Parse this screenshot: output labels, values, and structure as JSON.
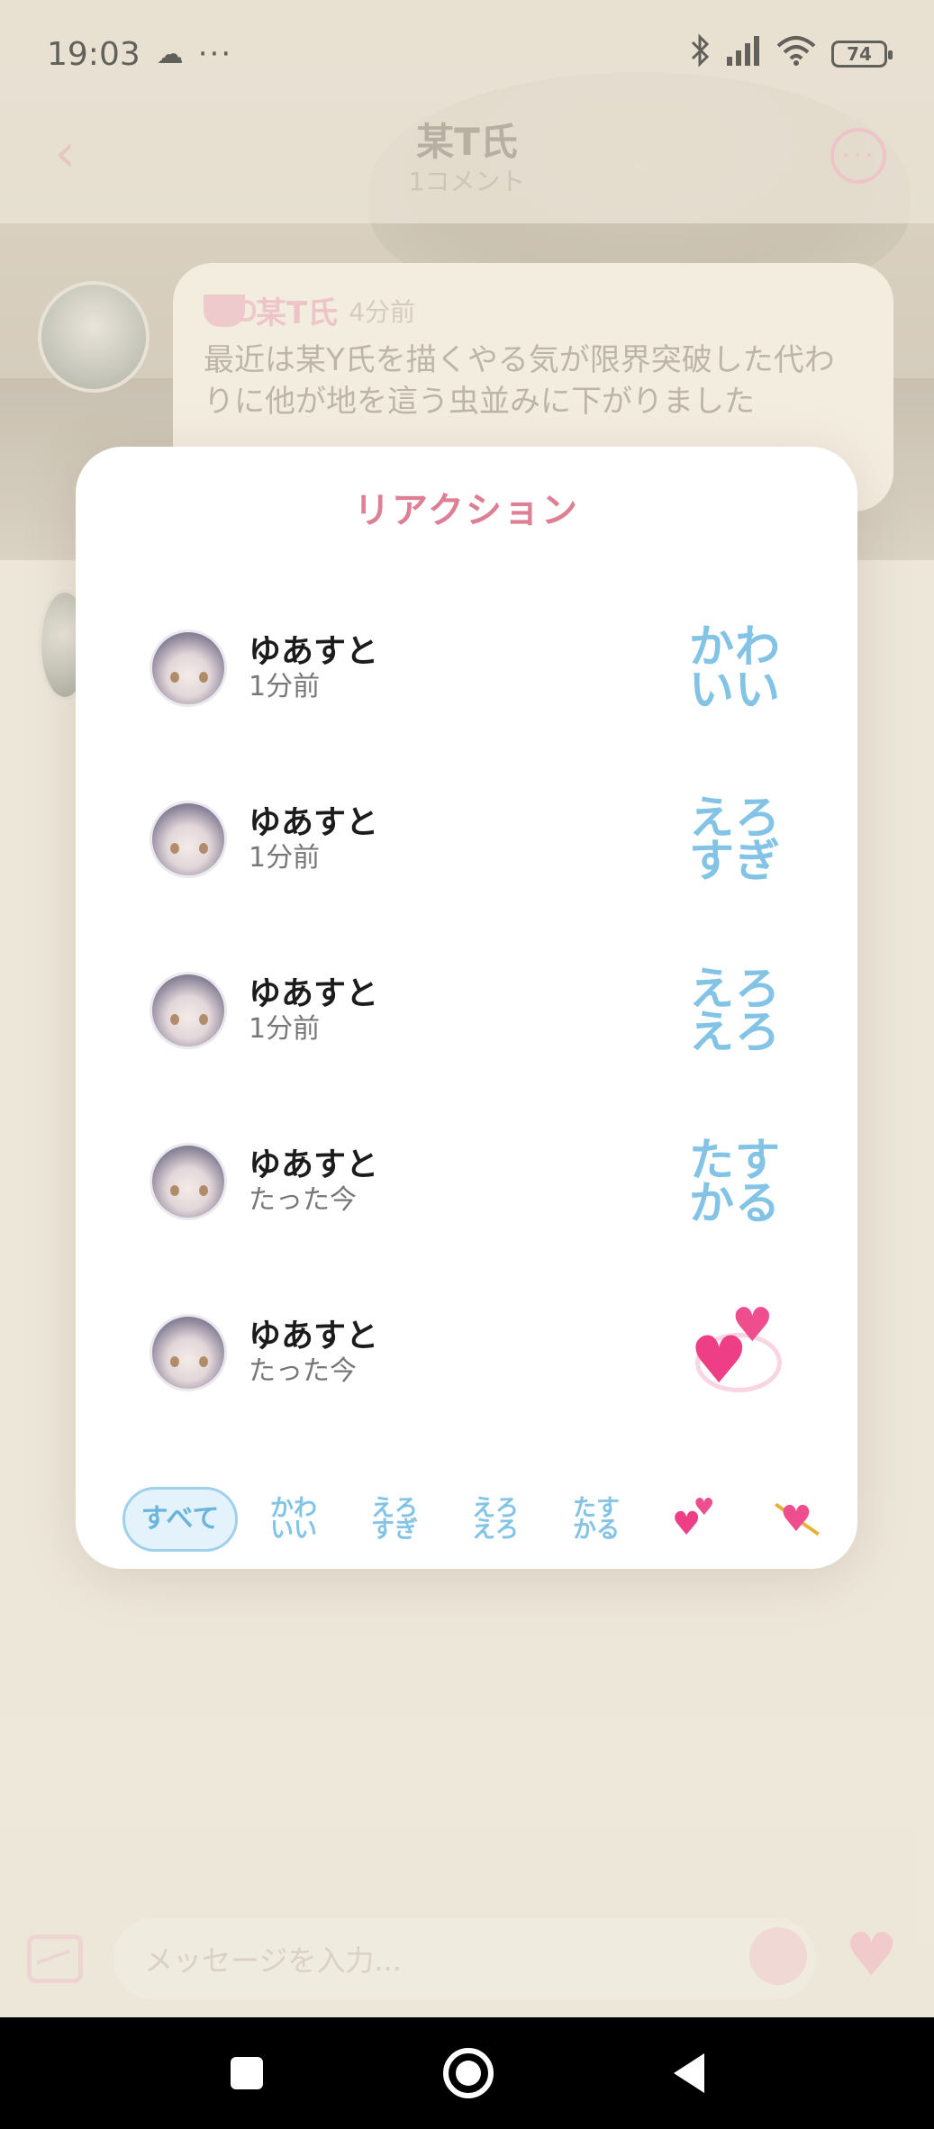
{
  "status_bar": {
    "time": "19:03",
    "more": "···",
    "battery": "74"
  },
  "nav": {
    "title": "某T氏",
    "subtitle": "1コメント"
  },
  "post": {
    "author": "某T氏",
    "time": "4分前",
    "text": "最近は某Y氏を描くやる気が限界突破した代わりに他が地を這う虫並みに下がりました"
  },
  "input": {
    "placeholder": "メッセージを入力..."
  },
  "modal": {
    "title": "リアクション",
    "reactions": [
      {
        "user": "ゆあすと",
        "time": "1分前",
        "stamp_line1": "かわ",
        "stamp_line2": "いい"
      },
      {
        "user": "ゆあすと",
        "time": "1分前",
        "stamp_line1": "えろ",
        "stamp_line2": "すぎ"
      },
      {
        "user": "ゆあすと",
        "time": "1分前",
        "stamp_line1": "えろ",
        "stamp_line2": "えろ"
      },
      {
        "user": "ゆあすと",
        "time": "たった今",
        "stamp_line1": "たす",
        "stamp_line2": "かる"
      },
      {
        "user": "ゆあすと",
        "time": "たった今",
        "stamp_icon": "two-hearts-icon"
      }
    ],
    "filters": [
      {
        "label": "すべて",
        "active": true
      },
      {
        "line1": "かわ",
        "line2": "いい"
      },
      {
        "line1": "えろ",
        "line2": "すぎ"
      },
      {
        "line1": "えろ",
        "line2": "えろ"
      },
      {
        "line1": "たす",
        "line2": "かる"
      },
      {
        "icon": "two-hearts-icon"
      },
      {
        "icon": "heart-with-arrow-icon"
      }
    ]
  },
  "colors": {
    "accent_pink": "#de8095",
    "stamp_blue": "#83c3e6",
    "heart_pink": "#ee3f86"
  }
}
